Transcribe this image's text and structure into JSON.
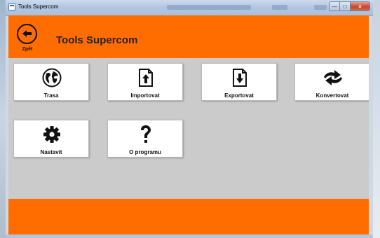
{
  "window": {
    "title": "Tools Supercom"
  },
  "header": {
    "back_label": "Zpět",
    "title": "Tools Supercom"
  },
  "tiles": [
    {
      "label": "Trasa",
      "icon": "globe-icon"
    },
    {
      "label": "Importovat",
      "icon": "import-icon"
    },
    {
      "label": "Exportovat",
      "icon": "export-icon"
    },
    {
      "label": "Konvertovat",
      "icon": "convert-arrows-icon"
    },
    {
      "label": "Nastavit",
      "icon": "gear-icon"
    },
    {
      "label": "O programu",
      "icon": "question-mark-icon"
    }
  ],
  "colors": {
    "accent": "#ff6d00",
    "workspace": "#cbcbcb"
  }
}
